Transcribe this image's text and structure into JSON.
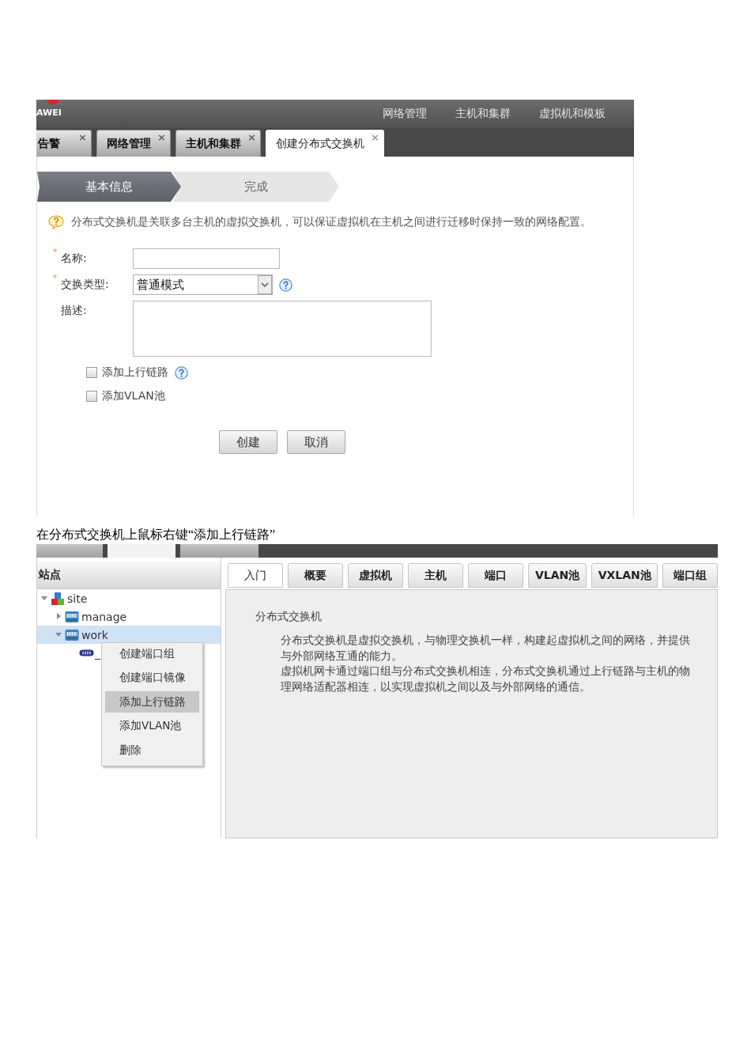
{
  "top_screenshot": {
    "header": {
      "logo_text": "AWEI",
      "nav": [
        "网络管理",
        "主机和集群",
        "虚拟机和模板"
      ]
    },
    "tabs": [
      {
        "label": "告警",
        "close": "×",
        "selected": false
      },
      {
        "label": "网络管理",
        "close": "×",
        "selected": false
      },
      {
        "label": "主机和集群",
        "close": "×",
        "selected": false
      },
      {
        "label": "创建分布式交换机",
        "close": "×",
        "selected": true
      }
    ],
    "wizard_steps": [
      {
        "label": "基本信息",
        "selected": true
      },
      {
        "label": "完成",
        "selected": false
      }
    ],
    "info_text": "分布式交换机是关联多台主机的虚拟交换机，可以保证虚拟机在主机之间进行迁移时保持一致的网络配置。",
    "form": {
      "fields": [
        {
          "kind": "text",
          "required_mark": "*",
          "label": "名称:",
          "help": false
        },
        {
          "kind": "select",
          "required_mark": "*",
          "label": "交换类型:",
          "value": "普通模式",
          "help": true
        },
        {
          "kind": "textarea",
          "label": "描述:",
          "help": false
        }
      ],
      "checkboxes": [
        {
          "label": "添加上行链路",
          "checked": false,
          "help": true
        },
        {
          "label": "添加VLAN池",
          "checked": false,
          "help": false
        }
      ],
      "buttons": [
        "创建",
        "取消"
      ]
    }
  },
  "caption": "在分布式交换机上鼠标右键“添加上行链路”",
  "bottom_screenshot": {
    "top_tabs": [
      {
        "selected": false
      },
      {
        "selected": true
      },
      {
        "selected": false
      }
    ],
    "sidebar": {
      "title": "站点",
      "tree": [
        {
          "kind": "site",
          "label": "site",
          "expanded": true,
          "selected": false,
          "children": [
            {
              "kind": "switch",
              "label": "manage",
              "expanded": false,
              "selected": false
            },
            {
              "kind": "switch",
              "label": "work",
              "expanded": true,
              "selected": true,
              "children": [
                {
                  "kind": "port_group",
                  "label": "_",
                  "selected": false
                }
              ]
            }
          ]
        }
      ]
    },
    "context_menu": [
      {
        "label": "创建端口组",
        "selected": false
      },
      {
        "label": "创建端口镜像",
        "selected": false
      },
      {
        "label": "添加上行链路",
        "selected": true
      },
      {
        "label": "添加VLAN池",
        "selected": false
      },
      {
        "label": "删除",
        "selected": false
      }
    ],
    "tabs": [
      {
        "label": "入门",
        "selected": true
      },
      {
        "label": "概要",
        "selected": false
      },
      {
        "label": "虚拟机",
        "selected": false
      },
      {
        "label": "主机",
        "selected": false
      },
      {
        "label": "端口",
        "selected": false
      },
      {
        "label": "VLAN池",
        "selected": false
      },
      {
        "label": "VXLAN池",
        "selected": false
      },
      {
        "label": "端口组",
        "selected": false
      }
    ],
    "content": {
      "title": "分布式交换机",
      "paragraphs": [
        "分布式交换机是虚拟交换机，与物理交换机一样，构建起虚拟机之间的网络，并提供与外部网络互通的能力。",
        "虚拟机网卡通过端口组与分布式交换机相连，分布式交换机通过上行链路与主机的物理网络适配器相连，以实现虚拟机之间以及与外部网络的通信。"
      ]
    }
  }
}
